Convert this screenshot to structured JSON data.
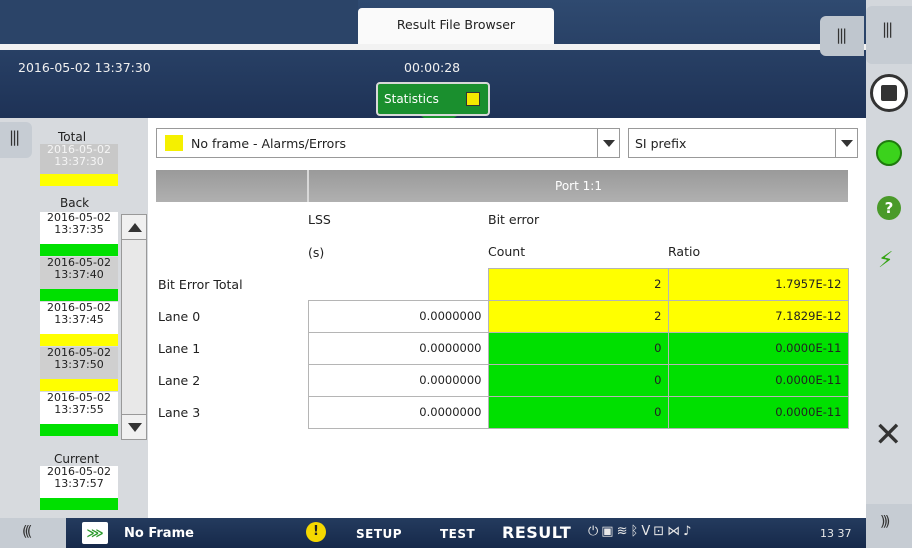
{
  "header": {
    "title": "Result File Browser",
    "datetime": "2016-05-02 13:37:30",
    "elapsed": "00:00:28",
    "statistics_button": "Statistics"
  },
  "left_panel": {
    "total_label": "Total",
    "total_entry": {
      "date": "2016-05-02",
      "time": "13:37:30",
      "status_color": "#ffff00"
    },
    "back_label": "Back",
    "entries": [
      {
        "date": "2016-05-02",
        "time": "13:37:35",
        "status_color": "#00e000"
      },
      {
        "date": "2016-05-02",
        "time": "13:37:40",
        "status_color": "#00e000"
      },
      {
        "date": "2016-05-02",
        "time": "13:37:45",
        "status_color": "#ffff00"
      },
      {
        "date": "2016-05-02",
        "time": "13:37:50",
        "status_color": "#ffff00"
      },
      {
        "date": "2016-05-02",
        "time": "13:37:55",
        "status_color": "#00e000"
      }
    ],
    "current_label": "Current",
    "current_entry": {
      "date": "2016-05-02",
      "time": "13:37:57",
      "status_color": "#00e000"
    }
  },
  "main": {
    "view_select": {
      "value": "No frame - Alarms/Errors",
      "indicator_color": "#f5f000"
    },
    "prefix_select": {
      "value": "SI prefix"
    },
    "port_label": "Port 1:1",
    "col_lss": "LSS",
    "col_lss_unit": "(s)",
    "col_bit_error": "Bit error",
    "col_count": "Count",
    "col_ratio": "Ratio",
    "rows": [
      {
        "label": "Bit Error Total",
        "lss": "",
        "count": "2",
        "ratio": "1.7957E-12",
        "status": "yellow"
      },
      {
        "label": "Lane 0",
        "lss": "0.0000000",
        "count": "2",
        "ratio": "7.1829E-12",
        "status": "yellow"
      },
      {
        "label": "Lane 1",
        "lss": "0.0000000",
        "count": "0",
        "ratio": "0.0000E-11",
        "status": "green"
      },
      {
        "label": "Lane 2",
        "lss": "0.0000000",
        "count": "0",
        "ratio": "0.0000E-11",
        "status": "green"
      },
      {
        "label": "Lane 3",
        "lss": "0.0000000",
        "count": "0",
        "ratio": "0.0000E-11",
        "status": "green"
      }
    ]
  },
  "bottom_bar": {
    "frame_label": "No Frame",
    "setup": "SETUP",
    "test": "TEST",
    "result": "RESULT",
    "clock": "13 37"
  },
  "colors": {
    "header_bg": "#1e3256",
    "status_green": "#00e000",
    "status_yellow": "#ffff00",
    "stats_button": "#1a8f2e"
  }
}
